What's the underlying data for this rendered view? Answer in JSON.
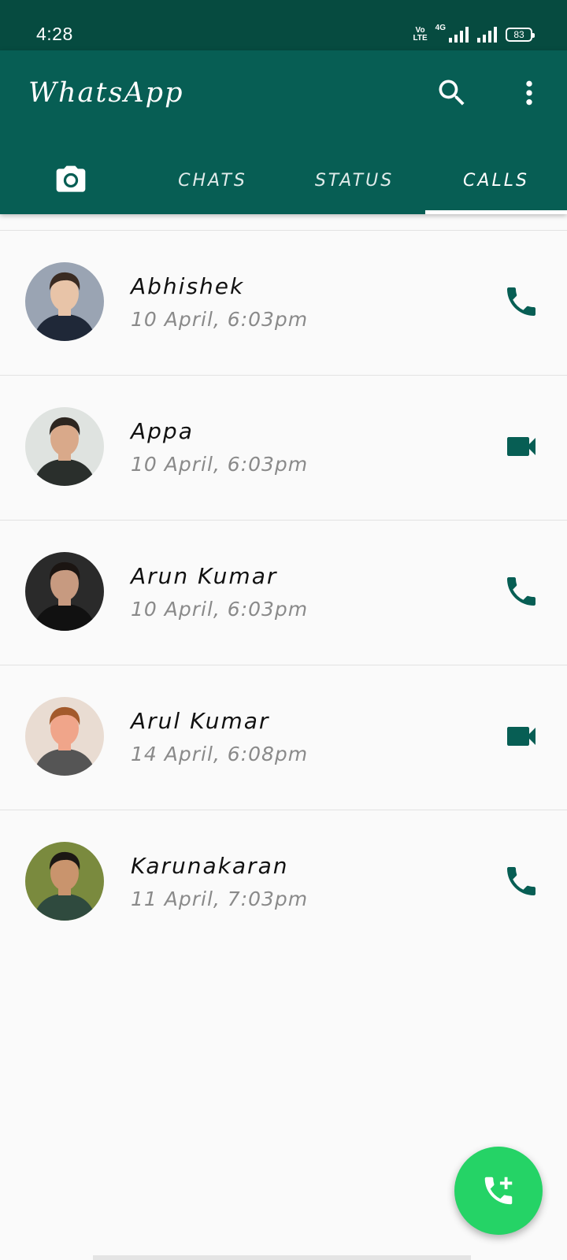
{
  "status_bar": {
    "time": "4:28",
    "volte": "Vo\nLTE",
    "network": "4G",
    "battery": "83"
  },
  "app": {
    "title": "WhatsApp",
    "icons": [
      "search-icon",
      "more-vert-icon",
      "camera-icon"
    ]
  },
  "tabs": [
    {
      "label": "CHATS"
    },
    {
      "label": "STATUS"
    },
    {
      "label": "CALLS",
      "active": true
    }
  ],
  "calls": [
    {
      "name": "Abhishek",
      "time": "10 April, 6:03pm",
      "type": "voice",
      "avatar_bg": "#9aa4b3",
      "avatar_skin": "#e8c4a8",
      "avatar_hair": "#3a2b22",
      "avatar_shirt": "#1f2838"
    },
    {
      "name": "Appa",
      "time": "10 April, 6:03pm",
      "type": "video",
      "avatar_bg": "#dfe3e0",
      "avatar_skin": "#d9a98a",
      "avatar_hair": "#2d2620",
      "avatar_shirt": "#2a2f2c"
    },
    {
      "name": "Arun Kumar",
      "time": "10 April, 6:03pm",
      "type": "voice",
      "avatar_bg": "#2a2a2a",
      "avatar_skin": "#c79a80",
      "avatar_hair": "#1b1512",
      "avatar_shirt": "#111"
    },
    {
      "name": "Arul Kumar",
      "time": "14 April, 6:08pm",
      "type": "video",
      "avatar_bg": "#e9dcd2",
      "avatar_skin": "#f0a58a",
      "avatar_hair": "#a35a2c",
      "avatar_shirt": "#555"
    },
    {
      "name": "Karunakaran",
      "time": "11 April, 7:03pm",
      "type": "voice",
      "avatar_bg": "#7a8a3e",
      "avatar_skin": "#c9946d",
      "avatar_hair": "#1c1814",
      "avatar_shirt": "#2f4a3e"
    }
  ],
  "fab": {
    "icon": "add-call-icon"
  },
  "colors": {
    "primary": "#075e54",
    "status_bar": "#064b40",
    "accent": "#25d366",
    "icon": "#075e54"
  }
}
